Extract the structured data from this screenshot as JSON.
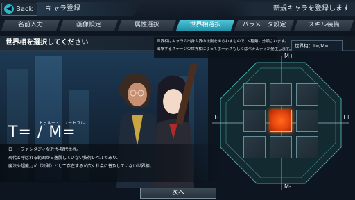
{
  "header": {
    "back_label": "Back",
    "title": "キャラ登録",
    "right_text": "新規キャラを登録します"
  },
  "tabs": [
    {
      "label": "名前入力",
      "active": false
    },
    {
      "label": "画像設定",
      "active": false
    },
    {
      "label": "属性選択",
      "active": false
    },
    {
      "label": "世界相選択",
      "active": true
    },
    {
      "label": "パラメータ設定",
      "active": false
    },
    {
      "label": "スキル装備",
      "active": false
    }
  ],
  "main": {
    "heading": "世界相を選択してください",
    "description": [
      "世界相はキャラの出身世界の法則をあらわすもので、9種類に分類されます。",
      "出撃するステージの世界相によってボーナスもしくはペナルティが発生します。"
    ],
    "world_phase_label": "世界相：T=/M="
  },
  "selection": {
    "ruby": "トゥルー・ニュートラル",
    "formula": "T= / M=",
    "info_lines": [
      "ロー・ファンタジィな近代-現代世界。",
      "現代と呼ばれる範囲から逸脱していない技術レベルであり、",
      "魔法や超能力が《法則》として存在するが広く社会に普及していない世界相。"
    ]
  },
  "grid": {
    "axis_labels": {
      "top": "M+",
      "bottom": "M-",
      "left": "T-",
      "right": "T+"
    },
    "selected_cell": "center",
    "colors": {
      "selected": "#e8470e",
      "cell": "#26333d"
    }
  },
  "footer": {
    "next_label": "次へ"
  }
}
